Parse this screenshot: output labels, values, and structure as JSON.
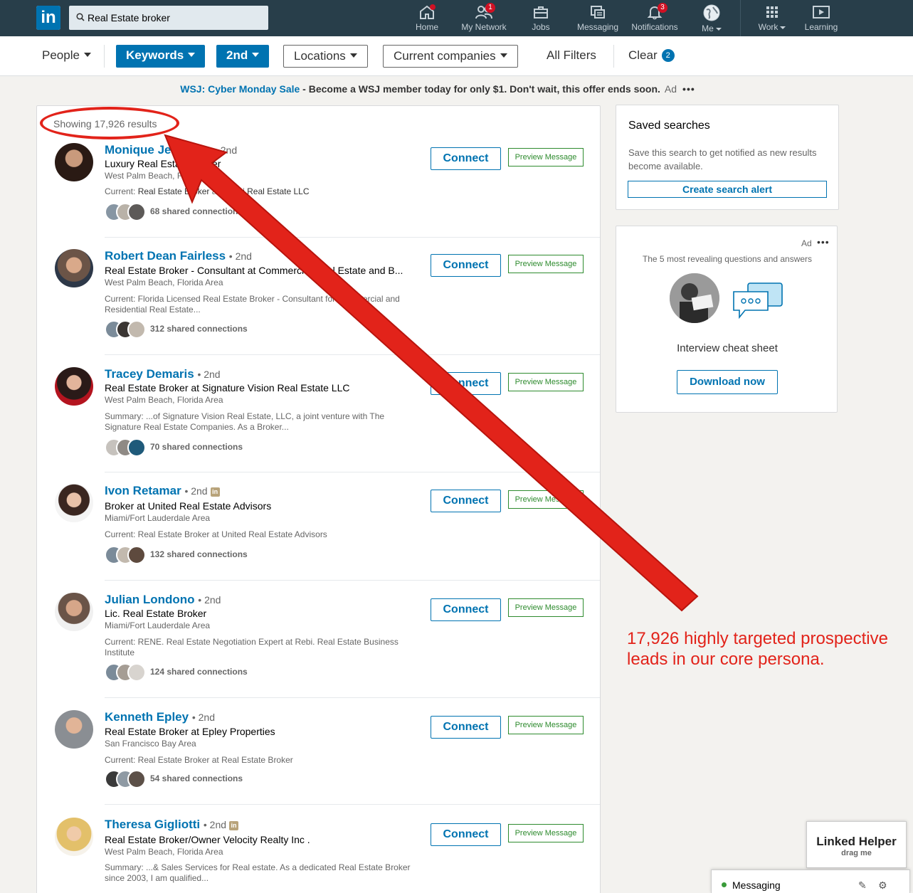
{
  "nav": {
    "search_value": "Real Estate broker",
    "items": [
      {
        "label": "Home",
        "badge": ""
      },
      {
        "label": "My Network",
        "badge": "1"
      },
      {
        "label": "Jobs",
        "badge": ""
      },
      {
        "label": "Messaging",
        "badge": ""
      },
      {
        "label": "Notifications",
        "badge": "3"
      },
      {
        "label": "Me",
        "badge": ""
      },
      {
        "label": "Work",
        "badge": ""
      },
      {
        "label": "Learning",
        "badge": ""
      }
    ]
  },
  "filters": {
    "people": "People",
    "keywords": "Keywords",
    "second": "2nd",
    "locations": "Locations",
    "current_companies": "Current companies",
    "all_filters": "All Filters",
    "clear": "Clear",
    "clear_count": "2"
  },
  "adline": {
    "brand": "WSJ: Cyber Monday Sale",
    "text": " - Become a WSJ member today for only $1. Don't wait, this offer ends soon.",
    "tag": "Ad",
    "dots": "•••"
  },
  "results": {
    "showing": "Showing 17,926 results",
    "connect_label": "Connect",
    "preview_label": "Preview Message",
    "items": [
      {
        "name": "Monique Jennings",
        "degree": "• 2nd",
        "headline": "Luxury Real Estate Broker",
        "location": "West Palm Beach, Florida Area",
        "snippet_pre": "Current: ",
        "snippet_b1": "Real Estate Broker",
        "snippet_mid": " at ",
        "snippet_b2": "Platini Real Estate LLC",
        "shared": "68 shared connections"
      },
      {
        "name": "Robert Dean Fairless",
        "degree": "• 2nd",
        "headline": "Real Estate Broker - Consultant at Commercial Real Estate and B...",
        "location": "West Palm Beach, Florida Area",
        "snippet": "Current: Florida Licensed Real Estate Broker - Consultant for Commercial and Residential Real Estate...",
        "shared": "312 shared connections"
      },
      {
        "name": "Tracey Demaris",
        "degree": "• 2nd",
        "headline": "Real Estate Broker at Signature Vision Real Estate LLC",
        "location": "West Palm Beach, Florida Area",
        "snippet": "Summary: ...of Signature Vision Real Estate, LLC, a joint venture with The Signature Real Estate Companies. As a Broker...",
        "shared": "70 shared connections"
      },
      {
        "name": "Ivon Retamar",
        "degree": "• 2nd",
        "headline": "Broker at United Real Estate Advisors",
        "location": "Miami/Fort Lauderdale Area",
        "snippet": "Current: Real Estate Broker at United Real Estate Advisors",
        "shared": "132 shared connections",
        "inbadge": "in"
      },
      {
        "name": "Julian Londono",
        "degree": "• 2nd",
        "headline": "Lic. Real Estate Broker",
        "location": "Miami/Fort Lauderdale Area",
        "snippet": "Current: RENE. Real Estate Negotiation Expert at Rebi. Real Estate Business Institute",
        "shared": "124 shared connections"
      },
      {
        "name": "Kenneth Epley",
        "degree": "• 2nd",
        "headline": "Real Estate Broker at Epley Properties",
        "location": "San Francisco Bay Area",
        "snippet": "Current: Real Estate Broker at Real Estate Broker",
        "shared": "54 shared connections"
      },
      {
        "name": "Theresa Gigliotti",
        "degree": "• 2nd",
        "headline": "Real Estate Broker/Owner Velocity Realty Inc .",
        "location": "West Palm Beach, Florida Area",
        "snippet": "Summary: ...& Sales Services for Real estate. As a dedicated Real Estate Broker since 2003, I am qualified...",
        "shared": "",
        "inbadge": "in"
      }
    ]
  },
  "saved": {
    "title": "Saved searches",
    "desc": "Save this search to get notified as new results become available.",
    "button": "Create search alert"
  },
  "adcard": {
    "tag": "Ad",
    "dots": "•••",
    "headline": "The 5 most revealing questions and answers",
    "subtitle": "Interview cheat sheet",
    "button": "Download now"
  },
  "annotation": {
    "text": "17,926 highly targeted prospective leads in our core persona."
  },
  "helper": {
    "title": "Linked Helper",
    "sub": "drag me"
  },
  "messaging": {
    "label": "Messaging"
  },
  "colors": {
    "nav_bg": "#283e4a",
    "brand_blue": "#0073b1",
    "annotation_red": "#e2231a",
    "preview_green": "#2e8b2e"
  }
}
